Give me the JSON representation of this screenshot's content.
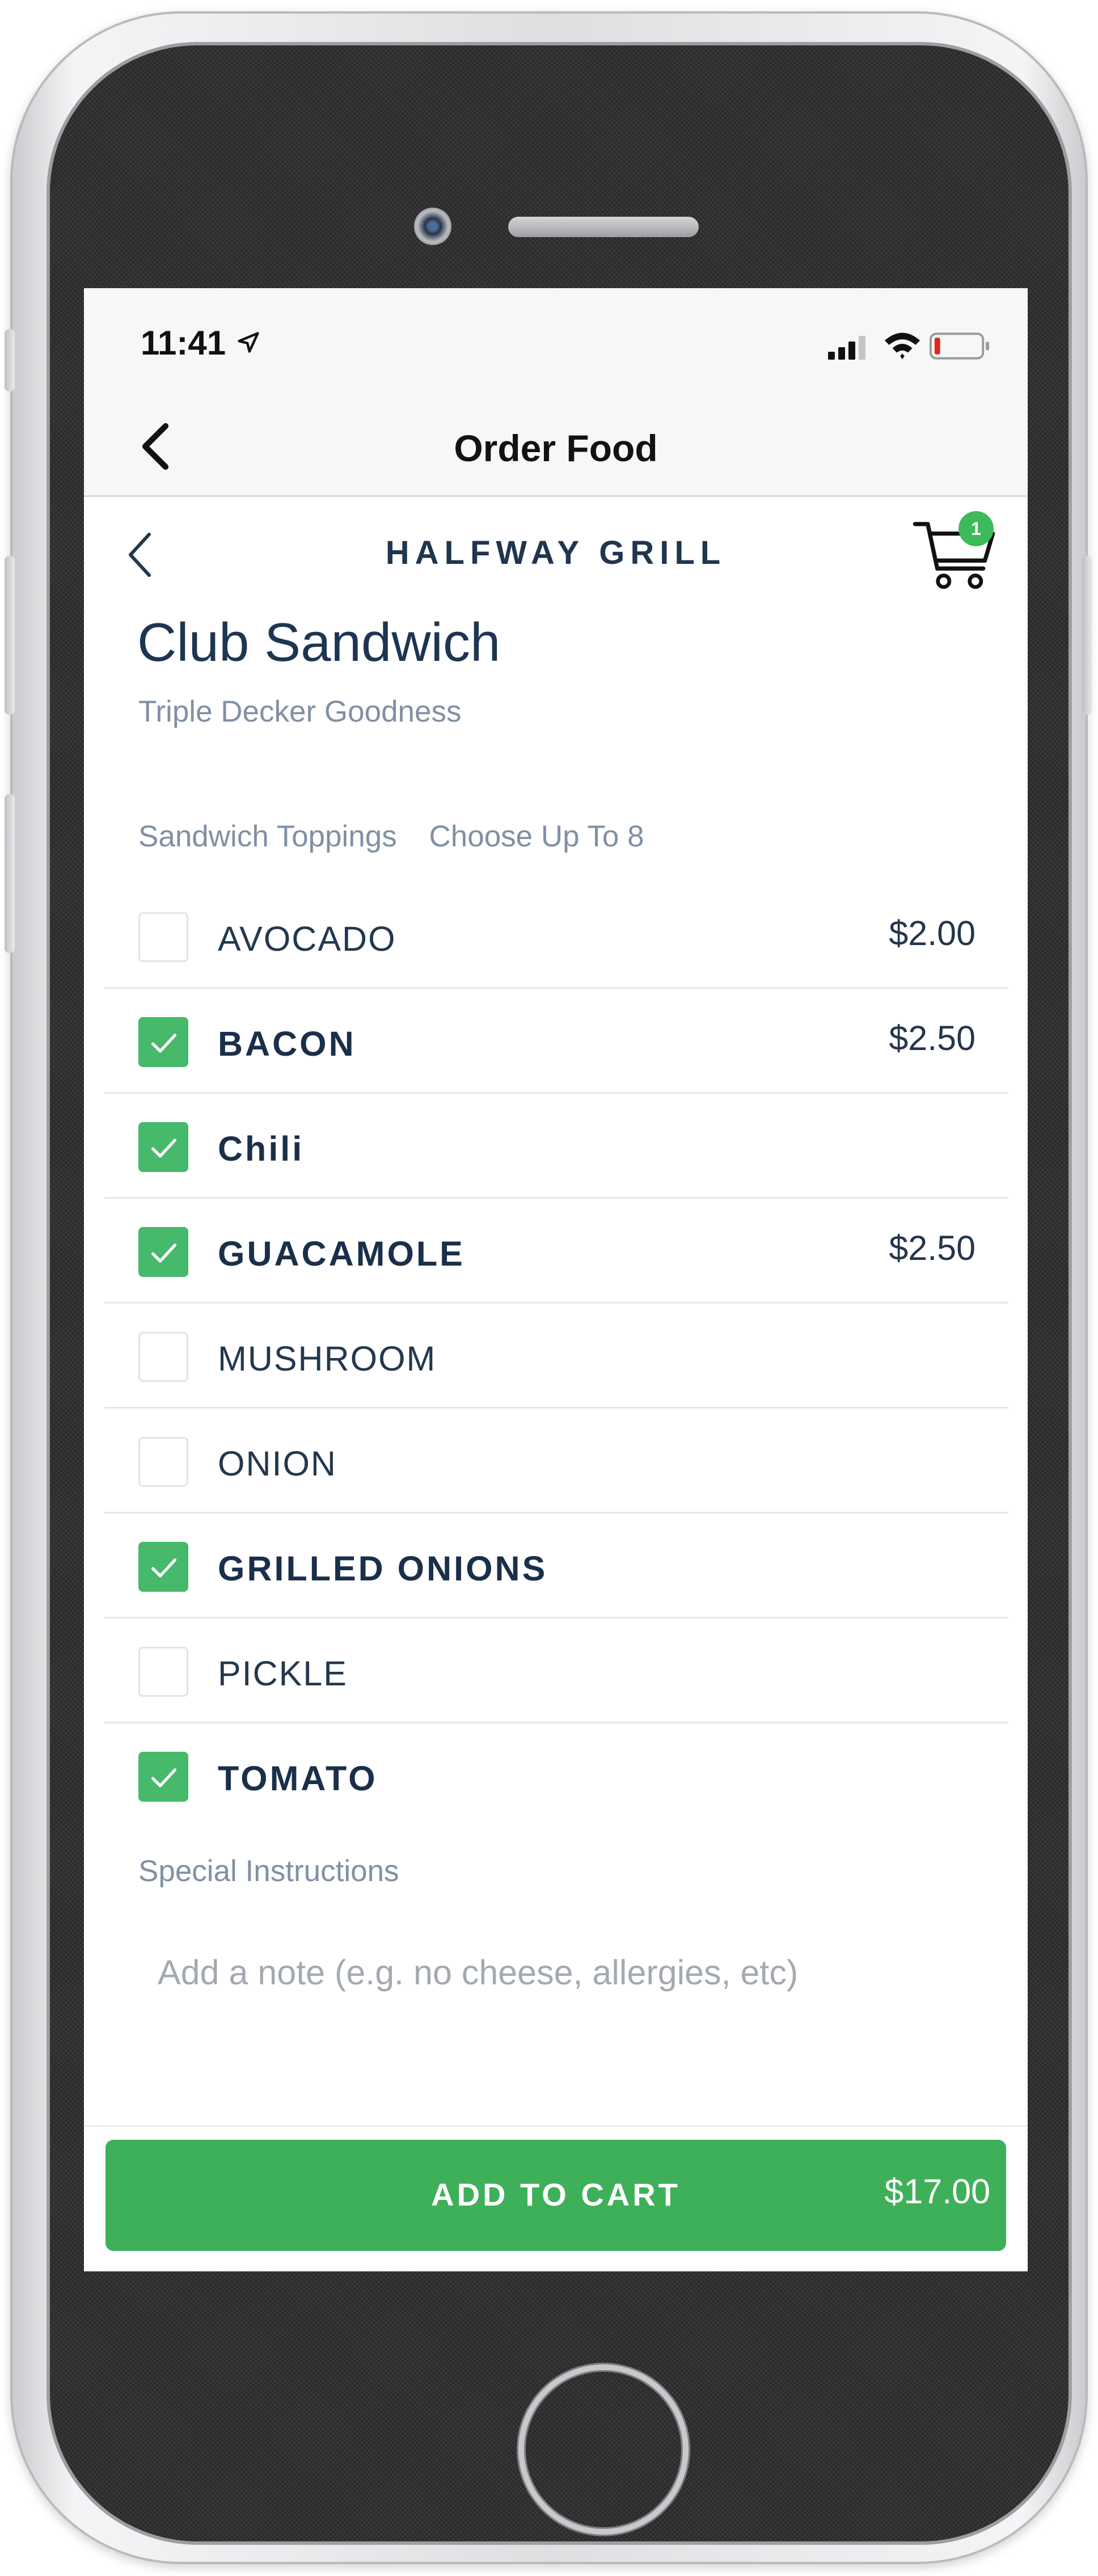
{
  "status_bar": {
    "time": "11:41"
  },
  "header": {
    "title": "Order Food"
  },
  "restaurant": {
    "name": "HALFWAY GRILL",
    "cart_count": "1"
  },
  "item": {
    "title": "Club Sandwich",
    "subtitle": "Triple Decker Goodness"
  },
  "toppings_section": {
    "label": "Sandwich Toppings",
    "limit": "Choose Up To 8"
  },
  "toppings": [
    {
      "label": "AVOCADO",
      "price": "$2.00",
      "checked": false
    },
    {
      "label": "BACON",
      "price": "$2.50",
      "checked": true
    },
    {
      "label": "Chili",
      "price": "",
      "checked": true
    },
    {
      "label": "GUACAMOLE",
      "price": "$2.50",
      "checked": true
    },
    {
      "label": "MUSHROOM",
      "price": "",
      "checked": false
    },
    {
      "label": "ONION",
      "price": "",
      "checked": false
    },
    {
      "label": "GRILLED ONIONS",
      "price": "",
      "checked": true
    },
    {
      "label": "PICKLE",
      "price": "",
      "checked": false
    },
    {
      "label": "TOMATO",
      "price": "",
      "checked": true
    }
  ],
  "special_instructions": {
    "label": "Special Instructions",
    "placeholder": "Add a note (e.g. no cheese, allergies, etc)",
    "value": ""
  },
  "cart_button": {
    "label": "ADD TO CART",
    "total": "$17.00"
  },
  "colors": {
    "accent_green": "#46b96a",
    "brand_navy": "#1d3552",
    "muted_text": "#8090a4"
  },
  "icons": [
    "location-arrow-icon",
    "signal-icon",
    "wifi-icon",
    "battery-icon",
    "back-chevron-icon",
    "cart-icon",
    "checkmark-icon"
  ]
}
